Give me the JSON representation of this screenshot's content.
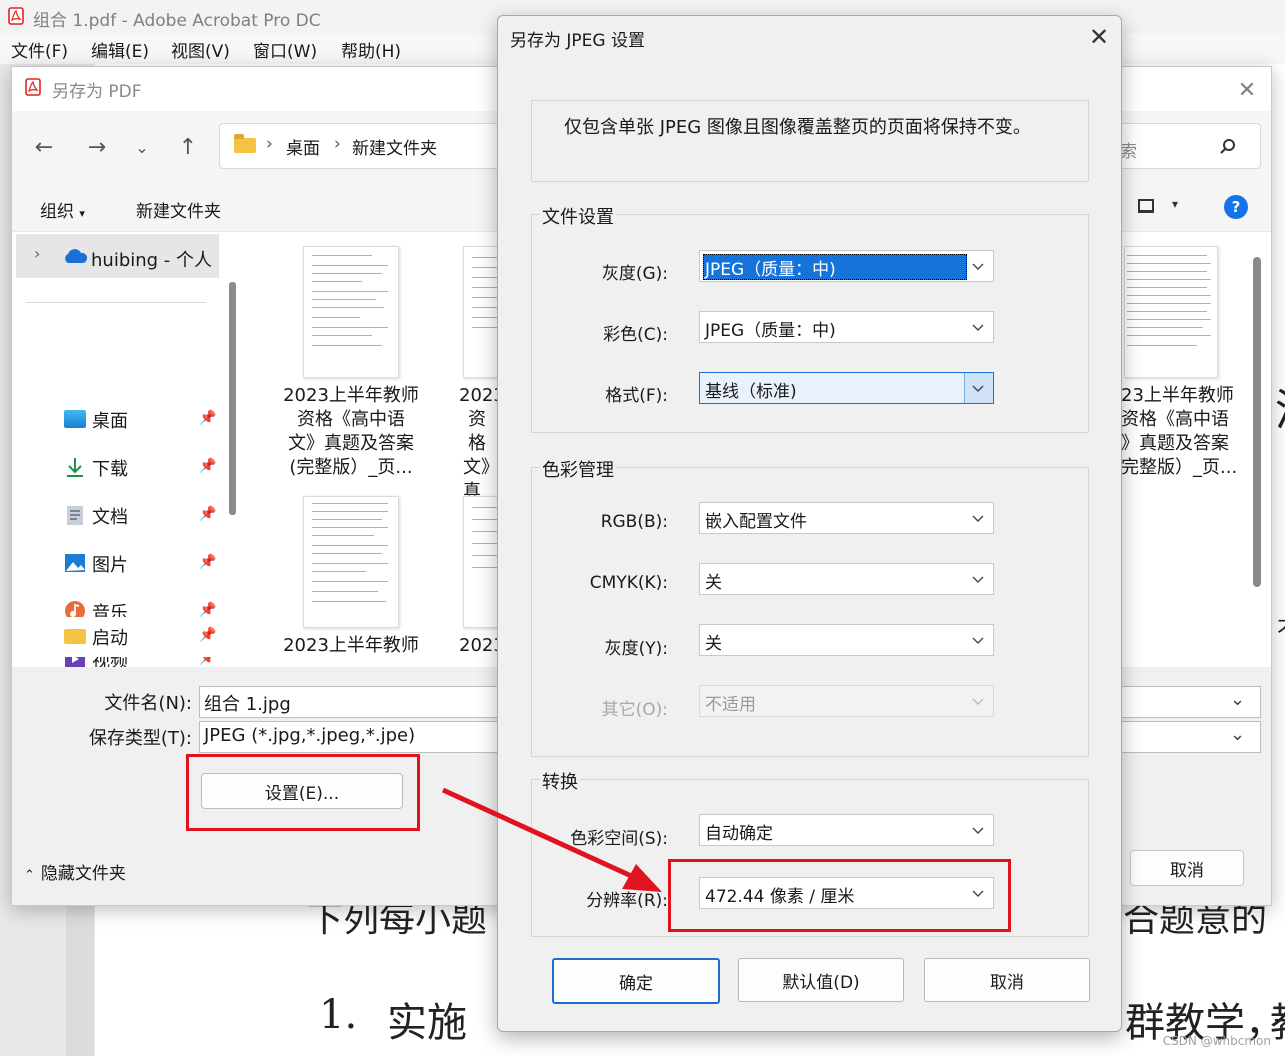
{
  "app": {
    "title": "组合 1.pdf - Adobe Acrobat Pro DC",
    "menu": [
      "文件(F)",
      "编辑(E)",
      "视图(V)",
      "窗口(W)",
      "帮助(H)"
    ],
    "doc_fragments": {
      "bottom_left": "下列每小题",
      "bottom_right": "合题意的",
      "item_number": "1.",
      "item_start": "实施",
      "item_end": "群教学，",
      "item_tail": "教",
      "right_edge": "清",
      "right_edge_small": "不"
    }
  },
  "saveas": {
    "title": "另存为 PDF",
    "breadcrumb": [
      "桌面",
      "新建文件夹"
    ],
    "search_hint": "索",
    "toolbar": {
      "organize": "组织",
      "new_folder": "新建文件夹"
    },
    "navpane": {
      "onedrive": "huibing - 个人",
      "items": [
        "桌面",
        "下载",
        "文档",
        "图片",
        "音乐",
        "视频",
        "启动"
      ]
    },
    "files": [
      {
        "line1": "2023上半年教师",
        "line2": "资格《高中语",
        "line3": "文》真题及答案",
        "line4": "(完整版）_页..."
      },
      {
        "line1": "2023_",
        "line2": "资格",
        "line3": "文》真",
        "line4": "(完整"
      },
      {
        "line1": "23上半年教师",
        "line2": "资格《高中语",
        "line3": "》真题及答案",
        "line4": "完整版）_页..."
      },
      {
        "line1": "2023上半年教师"
      },
      {
        "line1": "2023_"
      }
    ],
    "filename_label": "文件名(N):",
    "filename_value": "组合 1.jpg",
    "type_label": "保存类型(T):",
    "type_value": "JPEG (*.jpg,*.jpeg,*.jpe)",
    "settings_button": "设置(E)...",
    "cancel_button": "取消",
    "hide_folders": "隐藏文件夹"
  },
  "jpeg_dialog": {
    "title": "另存为 JPEG 设置",
    "notice": "仅包含单张 JPEG 图像且图像覆盖整页的页面将保持不变。",
    "file_settings": {
      "title": "文件设置",
      "grayscale_label": "灰度(G):",
      "grayscale_value": "JPEG（质量：中)",
      "color_label": "彩色(C):",
      "color_value": "JPEG（质量：中)",
      "format_label": "格式(F):",
      "format_value": "基线（标准)"
    },
    "color_mgmt": {
      "title": "色彩管理",
      "rgb_label": "RGB(B):",
      "rgb_value": "嵌入配置文件",
      "cmyk_label": "CMYK(K):",
      "cmyk_value": "关",
      "gray_label": "灰度(Y):",
      "gray_value": "关",
      "other_label": "其它(O):",
      "other_value": "不适用"
    },
    "conversion": {
      "title": "转换",
      "colorspace_label": "色彩空间(S):",
      "colorspace_value": "自动确定",
      "resolution_label": "分辨率(R):",
      "resolution_value": "472.44 像素 / 厘米"
    },
    "ok_button": "确定",
    "default_button": "默认值(D)",
    "cancel_button": "取消"
  },
  "watermark": "CSDN @whbcmon",
  "colors": {
    "highlight": "#e0141e",
    "accent": "#1a6fd1"
  }
}
